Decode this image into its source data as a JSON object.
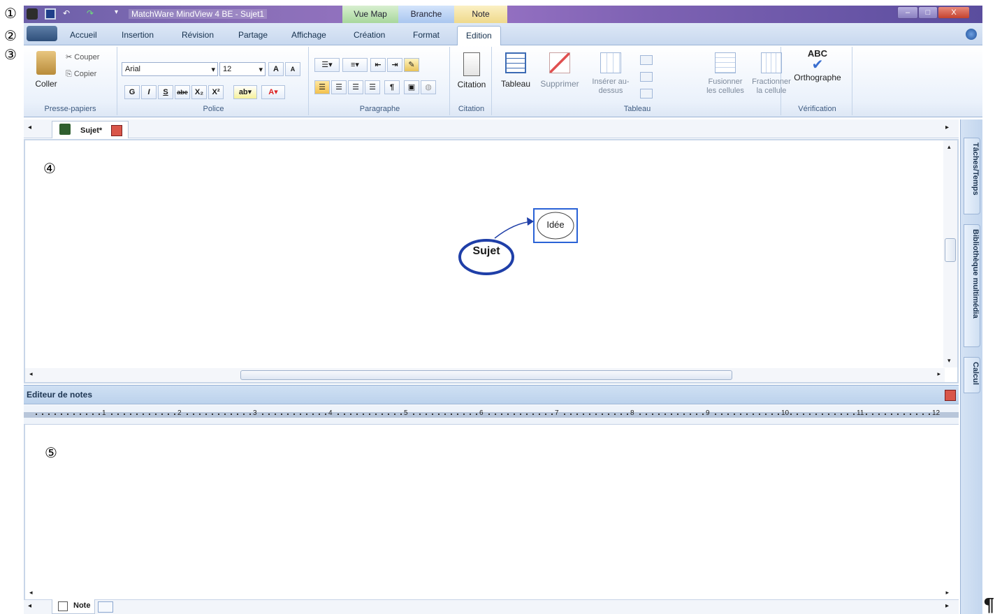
{
  "annotations": {
    "a1": "①",
    "a2": "②",
    "a3": "③",
    "a4": "④",
    "a5": "⑤",
    "pilcrow": "¶"
  },
  "titlebar": {
    "title": "MatchWare MindView 4 BE - Sujet1",
    "context_tabs": [
      "Vue Map",
      "Branche",
      "Note"
    ],
    "window_buttons": [
      "–",
      "□",
      "X"
    ]
  },
  "ribbon_tabs": [
    "Accueil",
    "Insertion",
    "Révision",
    "Partage",
    "Affichage",
    "Création",
    "Format",
    "Edition"
  ],
  "active_tab": "Edition",
  "ribbon": {
    "clipboard": {
      "label": "Presse-papiers",
      "paste": "Coller",
      "cut": "Couper",
      "copy": "Copier"
    },
    "font": {
      "label": "Police",
      "font_name": "Arial",
      "font_size": "12",
      "bold": "G",
      "italic": "I",
      "underline": "S",
      "strike": "abe",
      "subscript": "X₂",
      "superscript": "X²"
    },
    "paragraph": {
      "label": "Paragraphe"
    },
    "citation": {
      "label": "Citation",
      "button": "Citation"
    },
    "table": {
      "label": "Tableau",
      "table_btn": "Tableau",
      "delete_btn": "Supprimer",
      "insert_above": "Insérer au-dessus",
      "merge": "Fusionner les cellules",
      "split": "Fractionner la cellule"
    },
    "proofing": {
      "label": "Vérification",
      "spelling": "Orthographe",
      "abc": "ABC"
    }
  },
  "document_tab": {
    "label": "Sujet*"
  },
  "mindmap": {
    "root": "Sujet",
    "child": "Idée"
  },
  "note_editor": {
    "title": "Editeur de notes",
    "ruler_marks": [
      "1",
      "2",
      "3",
      "4",
      "5",
      "6",
      "7",
      "8",
      "9",
      "10",
      "11",
      "12"
    ]
  },
  "bottom_tabs": {
    "note": "Note"
  },
  "right_dock": {
    "tabs": [
      "Tâches/Temps",
      "Bibliothèque multimédia",
      "Calcul"
    ]
  },
  "colors": {
    "map_blue": "#1f3fa8",
    "titlebar_purple": "#7e62b3",
    "ribbon_blue": "#c8d8ef"
  }
}
